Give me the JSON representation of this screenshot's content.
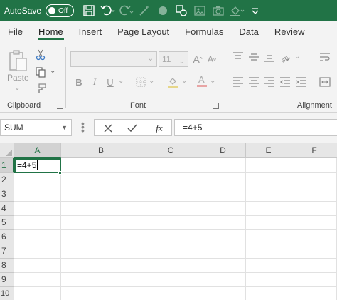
{
  "titlebar": {
    "autosave_label": "AutoSave",
    "autosave_state": "Off",
    "accent_color": "#217346"
  },
  "tabs": [
    {
      "label": "File"
    },
    {
      "label": "Home"
    },
    {
      "label": "Insert"
    },
    {
      "label": "Page Layout"
    },
    {
      "label": "Formulas"
    },
    {
      "label": "Data"
    },
    {
      "label": "Review"
    }
  ],
  "ribbon": {
    "clipboard": {
      "label": "Clipboard",
      "paste_label": "Paste"
    },
    "font": {
      "label": "Font",
      "font_name": "",
      "font_size": "11"
    },
    "alignment": {
      "label": "Alignment"
    }
  },
  "formula_bar": {
    "name_box": "SUM",
    "fx_label": "fx",
    "formula": "=4+5"
  },
  "sheet": {
    "columns": [
      "A",
      "B",
      "C",
      "D",
      "E",
      "F"
    ],
    "rows": [
      "1",
      "2",
      "3",
      "4",
      "5",
      "6",
      "7",
      "8",
      "9",
      "10"
    ],
    "active_cell_ref": "A1",
    "active_cell_value": "=4+5"
  }
}
